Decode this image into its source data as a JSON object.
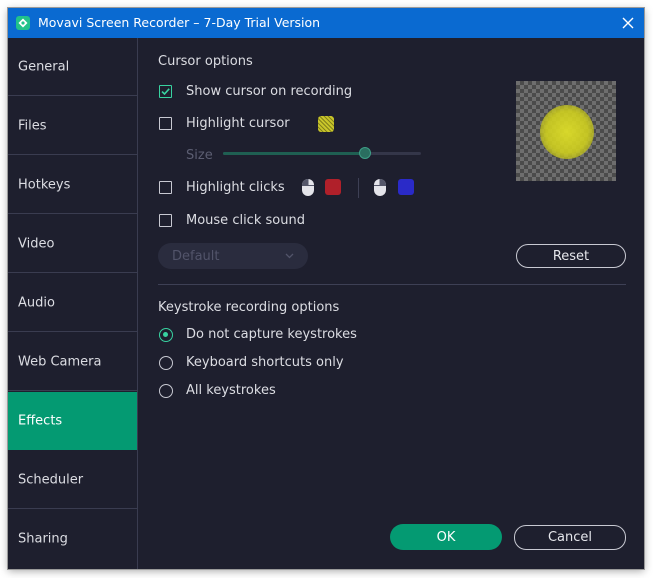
{
  "window": {
    "title": "Movavi Screen Recorder – 7-Day Trial Version",
    "app_icon": "movavi-logo-icon",
    "close_icon": "close-icon"
  },
  "sidebar": {
    "items": [
      {
        "label": "General"
      },
      {
        "label": "Files"
      },
      {
        "label": "Hotkeys"
      },
      {
        "label": "Video"
      },
      {
        "label": "Audio"
      },
      {
        "label": "Web Camera"
      },
      {
        "label": "Effects",
        "active": true
      },
      {
        "label": "Scheduler"
      },
      {
        "label": "Sharing"
      }
    ]
  },
  "cursor_options": {
    "title": "Cursor options",
    "show_cursor": {
      "label": "Show cursor on recording",
      "checked": true
    },
    "highlight_cursor": {
      "label": "Highlight cursor",
      "checked": false,
      "color": "#c9c62a"
    },
    "size": {
      "label": "Size",
      "value_fraction": 0.72,
      "enabled": false
    },
    "highlight_clicks": {
      "label": "Highlight clicks",
      "checked": false,
      "left_click_color": "#b0202a",
      "right_click_color": "#2a2ac8",
      "icons": [
        "mouse-left-click-icon",
        "mouse-right-click-icon"
      ]
    },
    "mouse_click_sound": {
      "label": "Mouse click sound",
      "checked": false
    },
    "sound_select": {
      "value": "Default",
      "enabled": false
    },
    "reset_label": "Reset"
  },
  "keystroke_options": {
    "title": "Keystroke recording options",
    "choices": [
      {
        "label": "Do not capture keystrokes",
        "selected": true
      },
      {
        "label": "Keyboard shortcuts only",
        "selected": false
      },
      {
        "label": "All keystrokes",
        "selected": false
      }
    ]
  },
  "footer": {
    "ok_label": "OK",
    "cancel_label": "Cancel"
  },
  "colors": {
    "accent": "#049a72",
    "titlebar": "#0a6ad1",
    "background": "#1e1f2e",
    "check": "#38d2a0"
  }
}
